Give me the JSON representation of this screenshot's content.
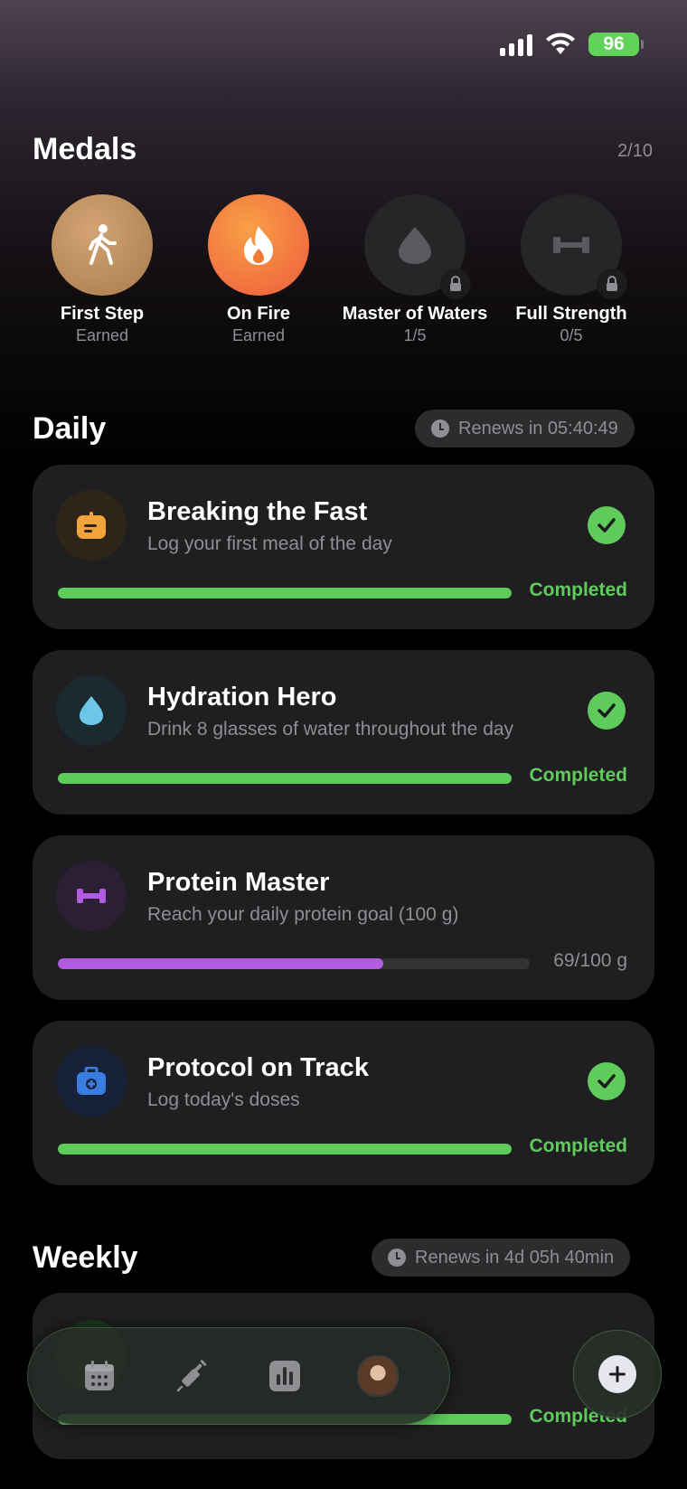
{
  "status_bar": {
    "battery": "96"
  },
  "medals": {
    "title": "Medals",
    "count": "2/10",
    "items": [
      {
        "name": "First Step",
        "status": "Earned",
        "icon": "walking-person-icon",
        "color": "#b9895a"
      },
      {
        "name": "On Fire",
        "status": "Earned",
        "icon": "flame-icon",
        "color": "#f07a38"
      },
      {
        "name": "Master of Waters",
        "status": "1/5",
        "icon": "water-drop-icon",
        "locked": true
      },
      {
        "name": "Full Strength",
        "status": "0/5",
        "icon": "dumbbell-icon",
        "locked": true
      }
    ]
  },
  "daily": {
    "title": "Daily",
    "renew": "Renews in 05:40:49",
    "cards": [
      {
        "title": "Breaking the Fast",
        "subtitle": "Log your first meal of the day",
        "icon": "meal-box-icon",
        "progress": 1.0,
        "label": "Completed",
        "color": "#f2a33a"
      },
      {
        "title": "Hydration Hero",
        "subtitle": "Drink 8 glasses of water throughout the day",
        "icon": "water-drop-icon",
        "progress": 1.0,
        "label": "Completed",
        "color": "#6cc6e8"
      },
      {
        "title": "Protein Master",
        "subtitle": "Reach your daily protein goal (100 g)",
        "icon": "dumbbell-icon",
        "progress": 0.69,
        "label": "69/100 g",
        "color": "#b15be0"
      },
      {
        "title": "Protocol on Track",
        "subtitle": "Log today's doses",
        "icon": "medical-kit-icon",
        "progress": 1.0,
        "label": "Completed",
        "color": "#3a7de0"
      }
    ]
  },
  "weekly": {
    "title": "Weekly",
    "renew": "Renews in 4d 05h 40min",
    "label": "Completed"
  },
  "tabbar": {
    "items": [
      "calendar-icon",
      "syringe-icon",
      "stats-icon",
      "profile-avatar"
    ]
  },
  "colors": {
    "success": "#5ecb5a",
    "card": "#1f1f21",
    "muted": "#8e8e93"
  }
}
